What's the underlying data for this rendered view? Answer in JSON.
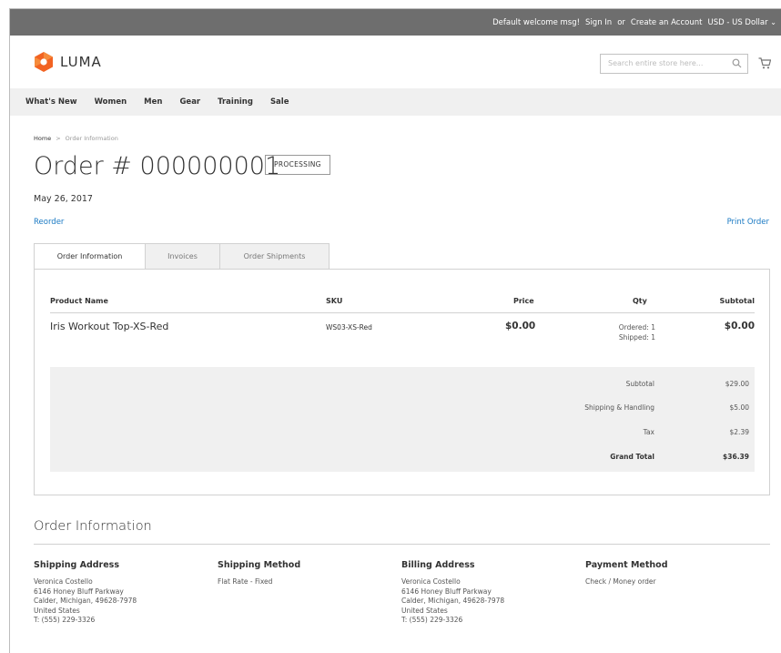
{
  "topbar": {
    "welcome": "Default welcome msg!",
    "sign_in": "Sign In",
    "or": "or",
    "create_account": "Create an Account",
    "currency": "USD - US Dollar"
  },
  "header": {
    "logo_text": "LUMA",
    "search_placeholder": "Search entire store here..."
  },
  "nav": {
    "items": [
      "What's New",
      "Women",
      "Men",
      "Gear",
      "Training",
      "Sale"
    ]
  },
  "breadcrumb": {
    "home": "Home",
    "separator": ">",
    "current": "Order Information"
  },
  "order": {
    "title": "Order # 000000001",
    "status": "PROCESSING",
    "date": "May 26, 2017",
    "reorder": "Reorder",
    "print": "Print Order"
  },
  "tabs": [
    "Order Information",
    "Invoices",
    "Order Shipments"
  ],
  "table": {
    "headers": {
      "product": "Product Name",
      "sku": "SKU",
      "price": "Price",
      "qty": "Qty",
      "subtotal": "Subtotal"
    },
    "rows": [
      {
        "product": "Iris Workout Top-XS-Red",
        "sku": "WS03-XS-Red",
        "price": "$0.00",
        "ordered": "Ordered: 1",
        "shipped": "Shipped: 1",
        "subtotal": "$0.00"
      }
    ]
  },
  "totals": [
    {
      "label": "Subtotal",
      "value": "$29.00"
    },
    {
      "label": "Shipping & Handling",
      "value": "$5.00"
    },
    {
      "label": "Tax",
      "value": "$2.39"
    },
    {
      "label": "Grand Total",
      "value": "$36.39"
    }
  ],
  "order_info": {
    "title": "Order Information",
    "shipping_address": {
      "heading": "Shipping Address",
      "lines": [
        "Veronica Costello",
        "6146 Honey Bluff Parkway",
        "Calder, Michigan, 49628-7978",
        "United States",
        "T: (555) 229-3326"
      ]
    },
    "shipping_method": {
      "heading": "Shipping Method",
      "lines": [
        "Flat Rate - Fixed"
      ]
    },
    "billing_address": {
      "heading": "Billing Address",
      "lines": [
        "Veronica Costello",
        "6146 Honey Bluff Parkway",
        "Calder, Michigan, 49628-7978",
        "United States",
        "T: (555) 229-3326"
      ]
    },
    "payment_method": {
      "heading": "Payment Method",
      "lines": [
        "Check / Money order"
      ]
    }
  },
  "colors": {
    "topbar": "#6e6e6e",
    "nav_bg": "#f0f0f0",
    "link": "#1979c3",
    "logo_orange": "#f26322"
  }
}
